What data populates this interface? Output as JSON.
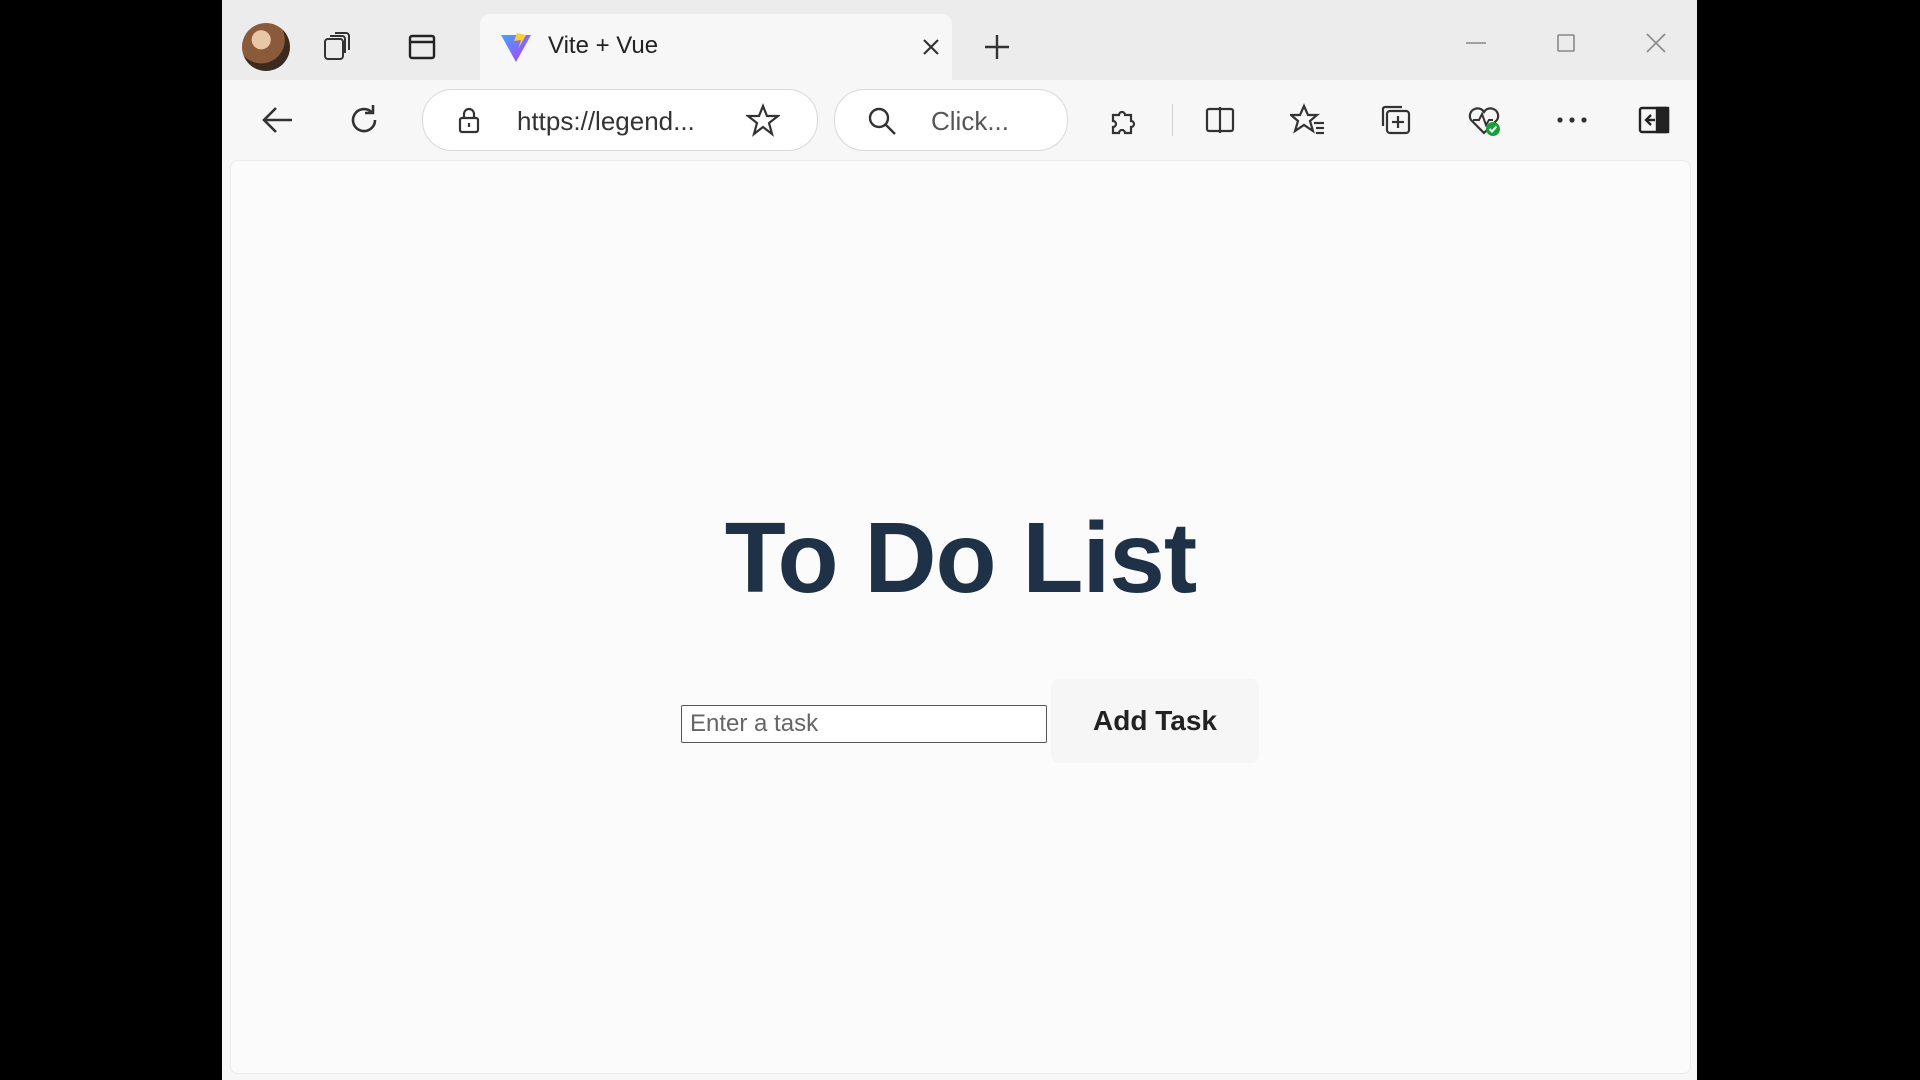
{
  "browser": {
    "tab": {
      "title": "Vite + Vue"
    },
    "address_bar": {
      "url": "https://legend..."
    },
    "search_box": {
      "placeholder": "Click..."
    }
  },
  "page": {
    "title": "To Do List",
    "task_input": {
      "placeholder": "Enter a task",
      "value": ""
    },
    "add_button_label": "Add Task"
  },
  "colors": {
    "title": "#1e3146",
    "page_background": "#fbfbfb",
    "vue_green": "#41b883",
    "vite_purple": "#a259ff"
  }
}
